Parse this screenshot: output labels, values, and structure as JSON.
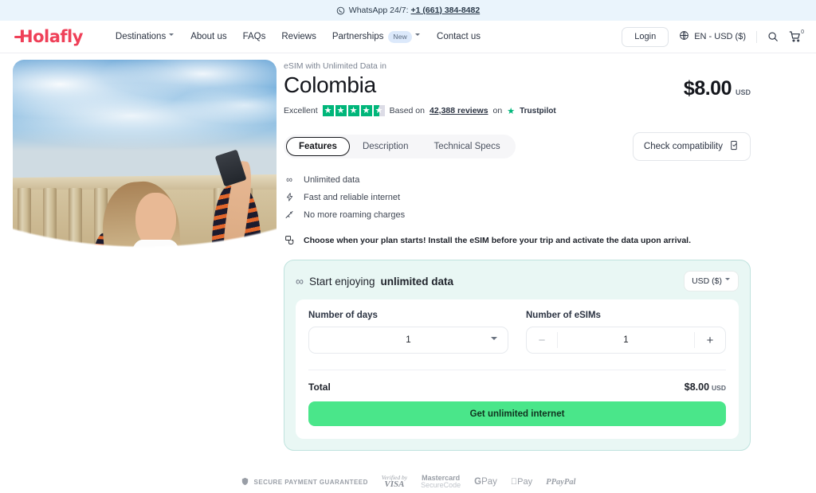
{
  "topbar": {
    "icon": "whatsapp-icon",
    "text": "WhatsApp 24/7:",
    "phone": "+1 (661) 384-8482"
  },
  "header": {
    "logo": "Holafly",
    "nav": [
      {
        "label": "Destinations",
        "has_chevron": true
      },
      {
        "label": "About us",
        "has_chevron": false
      },
      {
        "label": "FAQs",
        "has_chevron": false
      },
      {
        "label": "Reviews",
        "has_chevron": false
      },
      {
        "label": "Partnerships",
        "badge": "New",
        "has_chevron": true
      },
      {
        "label": "Contact us",
        "has_chevron": false
      }
    ],
    "login_label": "Login",
    "locale_label": "EN - USD ($)",
    "search_icon": "search-icon",
    "cart_icon": "cart-icon",
    "cart_count": "0"
  },
  "product": {
    "eyebrow": "eSIM with Unlimited Data in",
    "title": "Colombia",
    "price": "$8.00",
    "price_currency": "USD",
    "rating": {
      "word": "Excellent",
      "stars": 4.5,
      "based_on": "Based on",
      "reviews": "42,388 reviews",
      "on": "on",
      "platform": "Trustpilot"
    },
    "tabs": [
      {
        "label": "Features",
        "active": true
      },
      {
        "label": "Description",
        "active": false
      },
      {
        "label": "Technical Specs",
        "active": false
      }
    ],
    "compat_button": "Check compatibility",
    "compat_icon": "device-check-icon",
    "features": [
      {
        "icon": "infinity-icon",
        "glyph": "∞",
        "label": "Unlimited data"
      },
      {
        "icon": "lightning-icon",
        "glyph": "⚡",
        "label": "Fast and reliable internet"
      },
      {
        "icon": "no-roaming-icon",
        "glyph": "⚲",
        "label": "No more roaming charges"
      }
    ],
    "note": {
      "icon": "calendar-hand-icon",
      "text": "Choose when your plan starts! Install the eSIM before your trip and activate the data upon arrival."
    }
  },
  "purchase": {
    "header_icon": "infinity-icon",
    "header_text_plain": "Start enjoying ",
    "header_text_bold": "unlimited data",
    "currency_select": "USD ($)",
    "days_label": "Number of days",
    "days_value": "1",
    "esims_label": "Number of eSIMs",
    "esims_value": "1",
    "minus_label": "−",
    "plus_label": "+",
    "total_label": "Total",
    "total_value": "$8.00",
    "total_currency": "USD",
    "cta_label": "Get unlimited internet",
    "accent_green": "#4ae68a",
    "card_bg": "#e9f7f4",
    "card_border": "#bfe3de"
  },
  "payments": {
    "secure_text": "SECURE PAYMENT GUARANTEED",
    "visa_line1": "Verified by",
    "visa_line2": "VISA",
    "mc_line1": "Mastercard",
    "mc_line2": "SecureCode",
    "gpay": "Pay",
    "gpay_mark": "G",
    "apple_pay": "Pay",
    "paypal": "PayPal"
  },
  "colors": {
    "brand": "#ef4058",
    "trustpilot_green": "#00b67a",
    "topbar_bg": "#eaf4fc"
  }
}
